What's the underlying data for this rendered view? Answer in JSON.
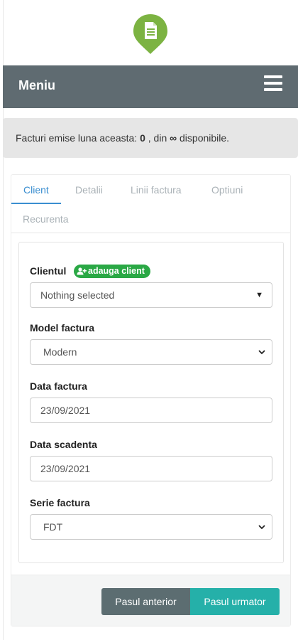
{
  "header": {
    "title": "Meniu",
    "menu_icon": "hamburger-icon"
  },
  "logo": {
    "icon": "invoice-pin-icon",
    "color": "#7cb342"
  },
  "info": {
    "prefix": "Facturi emise luna aceasta:",
    "count": "0",
    "middle": ", din",
    "limit_symbol": "∞",
    "suffix": "disponibile."
  },
  "tabs": [
    {
      "label": "Client",
      "active": true
    },
    {
      "label": "Detalii",
      "active": false
    },
    {
      "label": "Linii factura",
      "active": false
    },
    {
      "label": "Optiuni",
      "active": false
    },
    {
      "label": "Recurenta",
      "active": false
    }
  ],
  "form": {
    "client_label": "Clientul",
    "add_client_label": "adauga client",
    "client_value": "Nothing selected",
    "model_label": "Model factura",
    "model_value": "Modern",
    "date_label": "Data factura",
    "date_value": "23/09/2021",
    "due_label": "Data scadenta",
    "due_value": "23/09/2021",
    "series_label": "Serie factura",
    "series_value": "FDT"
  },
  "buttons": {
    "prev": "Pasul anterior",
    "next": "Pasul urmator"
  },
  "colors": {
    "header": "#5f6b71",
    "accent": "#3a8ed0",
    "badge": "#2aa845",
    "next": "#25b0a9",
    "prev": "#5c6d71"
  }
}
